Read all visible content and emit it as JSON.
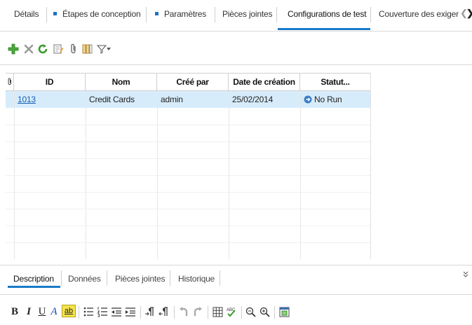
{
  "tabs": [
    {
      "label": "Détails"
    },
    {
      "label": "Étapes de conception"
    },
    {
      "label": "Paramètres"
    },
    {
      "label": "Pièces jointes"
    },
    {
      "label": "Configurations de test"
    },
    {
      "label": "Couverture des exigenc"
    }
  ],
  "toolbar_icons": [
    "add-icon",
    "delete-icon",
    "refresh-icon",
    "edit-icon",
    "attachment-icon",
    "columns-icon",
    "filter-icon",
    "dropdown-icon"
  ],
  "grid": {
    "columns": [
      "ID",
      "Nom",
      "Créé par",
      "Date de création",
      "Statut..."
    ],
    "rows": [
      {
        "id": "1013",
        "name": "Credit Cards",
        "created_by": "admin",
        "created_date": "25/02/2014",
        "status": "No Run"
      }
    ]
  },
  "bottom_tabs": [
    {
      "label": "Description"
    },
    {
      "label": "Données"
    },
    {
      "label": "Pièces jointes"
    },
    {
      "label": "Historique"
    }
  ],
  "format": {
    "bold": "B",
    "italic": "I",
    "underline": "U",
    "font_color": "A",
    "highlight": "ab"
  },
  "colors": {
    "accent": "#1a7ac8",
    "selected_row": "#d7ecfb",
    "link": "#1660b0"
  }
}
